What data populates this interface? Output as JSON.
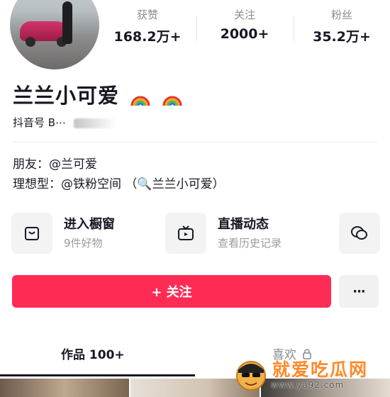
{
  "stats": [
    {
      "label": "获赞",
      "value": "168.2万+"
    },
    {
      "label": "关注",
      "value": "2000+"
    },
    {
      "label": "粉丝",
      "value": "35.2万+"
    }
  ],
  "profile": {
    "name": "兰兰小可爱",
    "id_label": "抖音号",
    "id_value": "B⋯"
  },
  "bio": {
    "line1": "朋友：@兰可爱",
    "line2": "理想型：@铁粉空间 （🔍兰兰小可爱）"
  },
  "cards": [
    {
      "title": "进入橱窗",
      "subtitle": "9件好物",
      "icon": "shop-window-icon"
    },
    {
      "title": "直播动态",
      "subtitle": "查看历史记录",
      "icon": "tv-icon"
    },
    {
      "icon": "chat-bubble-icon"
    }
  ],
  "actions": {
    "follow_label": "+ 关注",
    "more_label": "···"
  },
  "tabs": [
    {
      "label": "作品 100+"
    },
    {
      "label": "喜欢"
    }
  ],
  "watermark": {
    "title": "就爱吃瓜网",
    "url": "www.ya92.com"
  },
  "colors": {
    "accent": "#fe2c55",
    "text": "#161823",
    "muted": "#8a8b91"
  }
}
